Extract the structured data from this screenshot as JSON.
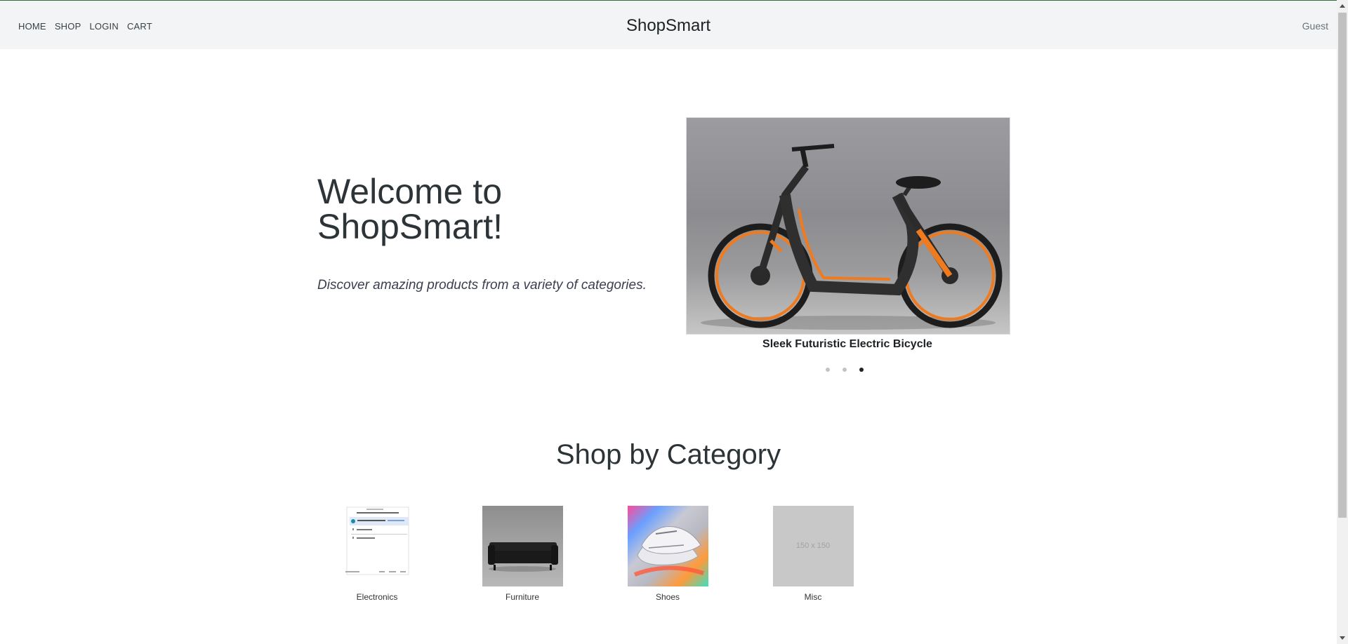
{
  "nav": {
    "links": [
      "HOME",
      "SHOP",
      "LOGIN",
      "CART"
    ],
    "brand": "ShopSmart",
    "user": "Guest"
  },
  "hero": {
    "title_line1": "Welcome to",
    "title_line2": "ShopSmart!",
    "subtitle": "Discover amazing products from a variety of categories."
  },
  "carousel": {
    "caption": "Sleek Futuristic Electric Bicycle",
    "slide_count": 3,
    "active_slide": 3
  },
  "categories_section": {
    "title": "Shop by Category",
    "items": [
      {
        "label": "Electronics"
      },
      {
        "label": "Furniture"
      },
      {
        "label": "Shoes"
      },
      {
        "label": "Misc",
        "placeholder_text": "150 x 150"
      }
    ]
  },
  "colors": {
    "navbar_bg": "#f3f4f5",
    "bike_accent": "#f07a1e",
    "placeholder_bg": "#c8c8c8"
  }
}
